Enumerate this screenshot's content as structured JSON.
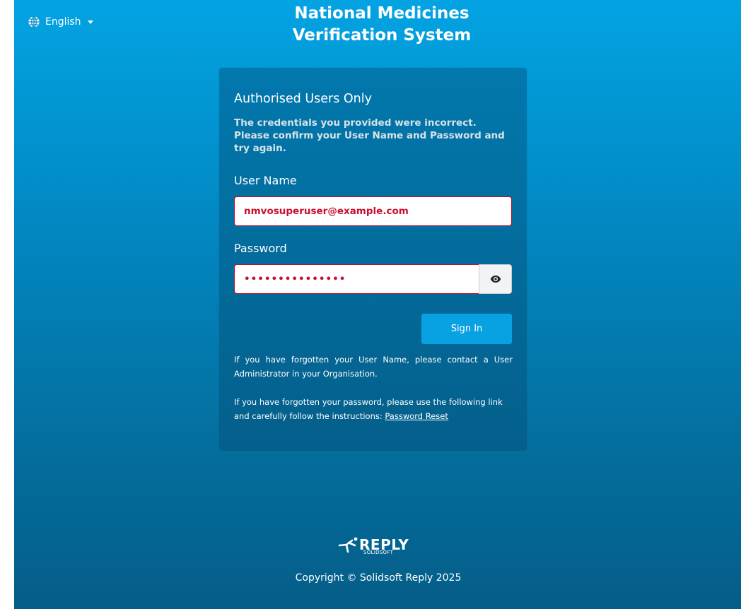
{
  "language": {
    "selected": "English"
  },
  "app": {
    "title_line1": "National Medicines",
    "title_line2": "Verification System"
  },
  "login": {
    "heading": "Authorised Users Only",
    "error": "The credentials you provided were incorrect. Please confirm your User Name and Password and try again.",
    "username_label": "User Name",
    "username_value": "nmvosuperuser@example.com",
    "password_label": "Password",
    "password_mask": "•••••••••••••••",
    "signin_label": "Sign In",
    "help_username": "If you have forgotten your User Name, please contact a User Administrator in your Organisation.",
    "help_password_prefix": "If you have forgotten your password, please use the following link and carefully follow the instructions: ",
    "reset_link": "Password Reset"
  },
  "footer": {
    "brand": "REPLY",
    "brand_sub": "SOLIDSOFT",
    "copyright": "Copyright © Solidsoft Reply 2025"
  },
  "colors": {
    "brand_blue": "#03a3e3",
    "error_red": "#c8102e",
    "button_blue": "#08a1e2"
  },
  "icons": {
    "language": "globe-icon",
    "toggle_password": "eye-icon",
    "brand": "reply-runner-icon"
  }
}
